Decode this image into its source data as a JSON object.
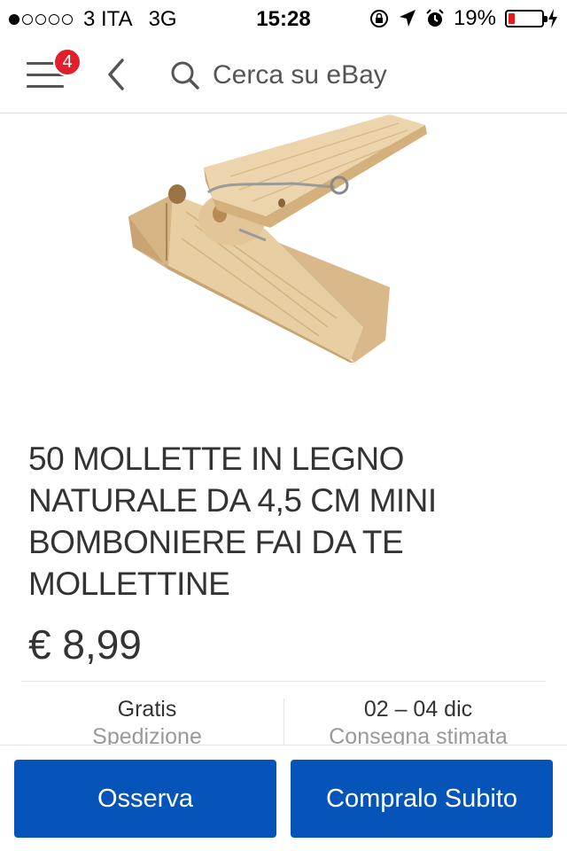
{
  "status_bar": {
    "carrier": "3 ITA",
    "network": "3G",
    "time": "15:28",
    "battery_percent": "19%",
    "battery_level": 0.19
  },
  "nav": {
    "notification_count": "4",
    "search_placeholder": "Cerca su eBay"
  },
  "product": {
    "title": "50 MOLLETTE IN LEGNO NATURALE DA 4,5 CM MINI BOMBONIERE FAI DA TE MOLLETTINE",
    "price": "€ 8,99"
  },
  "info": {
    "shipping_value": "Gratis",
    "shipping_label": "Spedizione",
    "delivery_value": "02 – 04 dic",
    "delivery_label": "Consegna stimata"
  },
  "actions": {
    "watch_label": "Osserva",
    "buy_label": "Compralo Subito"
  },
  "colors": {
    "ebay_blue": "#0654ba",
    "badge_red": "#e0202a",
    "battery_red": "#e21b1b"
  },
  "icons": [
    "menu-icon",
    "back-chevron-icon",
    "search-icon",
    "lock-rotation-icon",
    "location-arrow-icon",
    "alarm-icon",
    "battery-icon",
    "charging-bolt-icon"
  ]
}
